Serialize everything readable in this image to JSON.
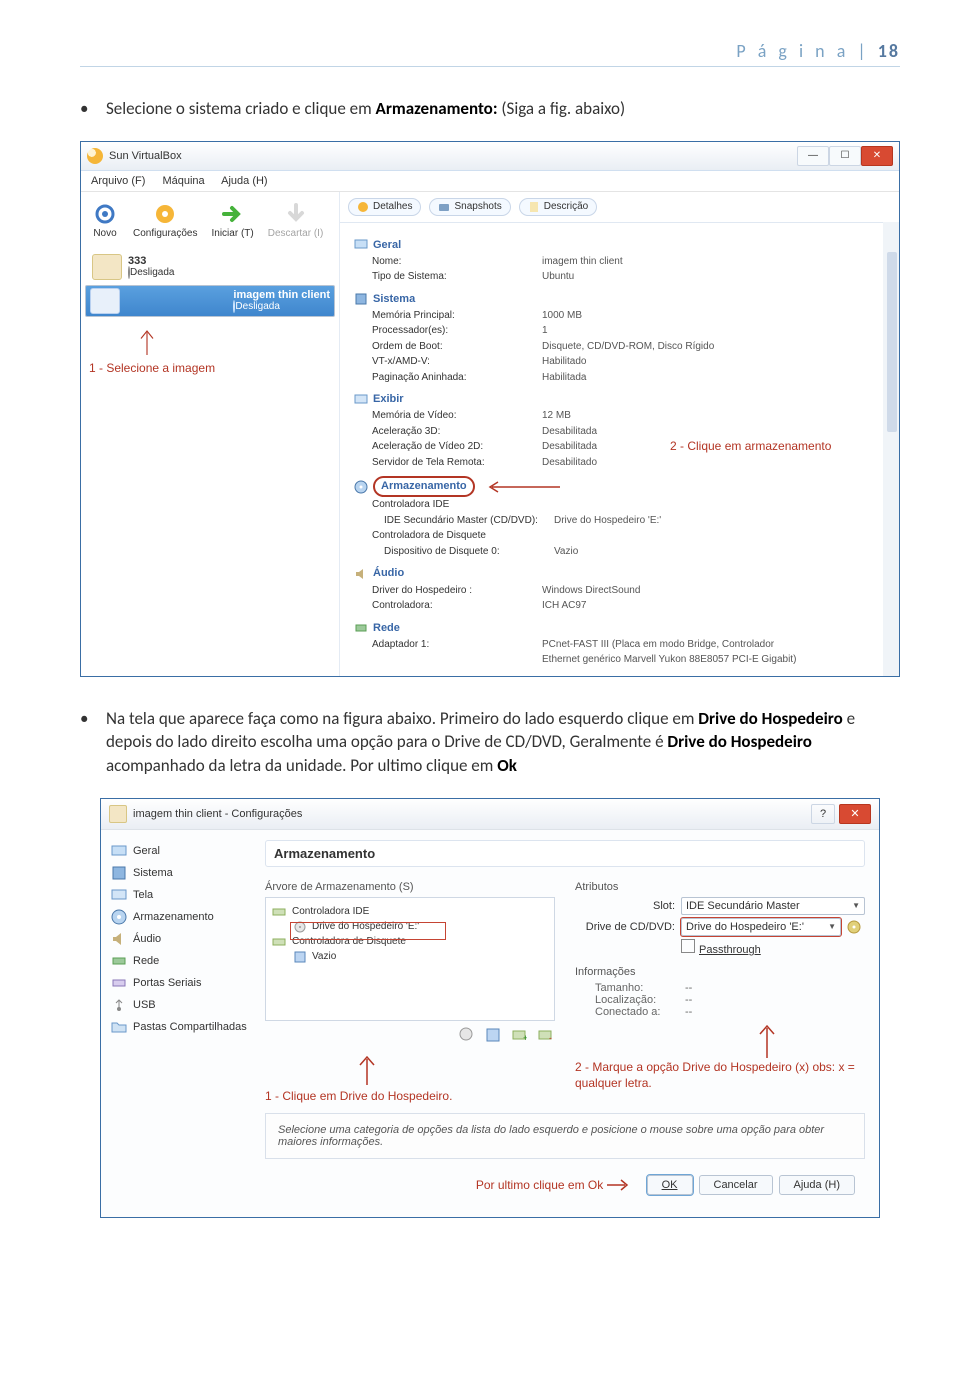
{
  "header": {
    "label": "P á g i n a |",
    "num": "18"
  },
  "bullet1": {
    "pre": "Selecione o sistema criado e clique em ",
    "bold": "Armazenamento:",
    "post": " (Siga a fig. abaixo)"
  },
  "vb": {
    "title": "Sun VirtualBox",
    "menu": {
      "arquivo": "Arquivo (F)",
      "maquina": "Máquina",
      "ajuda": "Ajuda (H)"
    },
    "toolbar": {
      "novo": "Novo",
      "config": "Configurações",
      "iniciar": "Iniciar (T)",
      "descartar": "Descartar (I)"
    },
    "vm1": {
      "name": "333",
      "status": "Desligada"
    },
    "vm2": {
      "name": "imagem thin client",
      "status": "Desligada"
    },
    "annot1": "1 - Selecione a imagem",
    "tabs": {
      "det": "Detalhes",
      "snap": "Snapshots",
      "desc": "Descrição"
    },
    "geral": {
      "hdr": "Geral",
      "nome_k": "Nome:",
      "nome_v": "imagem thin client",
      "tipo_k": "Tipo de Sistema:",
      "tipo_v": "Ubuntu"
    },
    "sistema": {
      "hdr": "Sistema",
      "mem_k": "Memória Principal:",
      "mem_v": "1000 MB",
      "proc_k": "Processador(es):",
      "proc_v": "1",
      "boot_k": "Ordem de Boot:",
      "boot_v": "Disquete, CD/DVD-ROM, Disco Rígido",
      "vt_k": "VT-x/AMD-V:",
      "vt_v": "Habilitado",
      "pag_k": "Paginação Aninhada:",
      "pag_v": "Habilitada"
    },
    "exibir": {
      "hdr": "Exibir",
      "vid_k": "Memória de Vídeo:",
      "vid_v": "12 MB",
      "a3d_k": "Aceleração 3D:",
      "a3d_v": "Desabilitada",
      "a2d_k": "Aceleração de Vídeo 2D:",
      "a2d_v": "Desabilitada",
      "tele_k": "Servidor de Tela Remota:",
      "tele_v": "Desabilitado"
    },
    "armz": {
      "hdr": "Armazenamento",
      "ctrl_k": "Controladora IDE",
      "ide_k": "IDE Secundário Master (CD/DVD):",
      "ide_v": "Drive do Hospedeiro 'E:'",
      "disq_k": "Controladora de Disquete",
      "d0_k": "Dispositivo de Disquete 0:",
      "d0_v": "Vazio"
    },
    "annot2": "2 - Clique em armazenamento",
    "audio": {
      "hdr": "Áudio",
      "drv_k": "Driver do Hospedeiro :",
      "drv_v": "Windows DirectSound",
      "ctrl_k": "Controladora:",
      "ctrl_v": "ICH AC97"
    },
    "rede": {
      "hdr": "Rede",
      "ad_k": "Adaptador 1:",
      "ad_v": "PCnet-FAST III (Placa em modo Bridge, Controlador Ethernet genérico Marvell Yukon 88E8057 PCI-E Gigabit)"
    }
  },
  "bullet2": {
    "pre": "Na tela que aparece faça como na figura abaixo. Primeiro do lado esquerdo clique em ",
    "b1": "Drive do Hospedeiro",
    "mid": " e depois do lado direito escolha uma opção para o Drive de CD/DVD, Geralmente é ",
    "b2": "Drive do Hospedeiro",
    "post1": " acompanhado da letra da unidade. Por ultimo clique em ",
    "b3": "Ok"
  },
  "cfg": {
    "title": "imagem thin client - Configurações",
    "side": {
      "geral": "Geral",
      "sistema": "Sistema",
      "tela": "Tela",
      "armz": "Armazenamento",
      "audio": "Áudio",
      "rede": "Rede",
      "portas": "Portas Seriais",
      "usb": "USB",
      "pastas": "Pastas Compartilhadas"
    },
    "main_h": "Armazenamento",
    "tree_lab": "Árvore de Armazenamento (S)",
    "tree": {
      "c_ide": "Controladora IDE",
      "cd": "Drive do Hospedeiro 'E:'",
      "c_disq": "Controladora de Disquete",
      "vazio": "Vazio"
    },
    "annot3": "1 - Clique em Drive do Hospedeiro.",
    "attr_lab": "Atributos",
    "slot_k": "Slot:",
    "slot_v": "IDE Secundário Master",
    "drive_k": "Drive de CD/DVD:",
    "drive_v": "Drive do Hospedeiro 'E:'",
    "pass": "Passthrough",
    "info_lab": "Informações",
    "info": {
      "tam_k": "Tamanho:",
      "tam_v": "--",
      "loc_k": "Localização:",
      "loc_v": "--",
      "con_k": "Conectado a:",
      "con_v": "--"
    },
    "annot4": "2 - Marque a opção Drive do Hospedeiro (x) obs: x = qualquer letra.",
    "help": "Selecione uma categoria de opções da lista do lado esquerdo e posicione o mouse sobre uma opção para obter maiores informações.",
    "annot5": "Por ultimo clique em Ok",
    "btn_ok": "OK",
    "btn_cancel": "Cancelar",
    "btn_help": "Ajuda (H)"
  }
}
